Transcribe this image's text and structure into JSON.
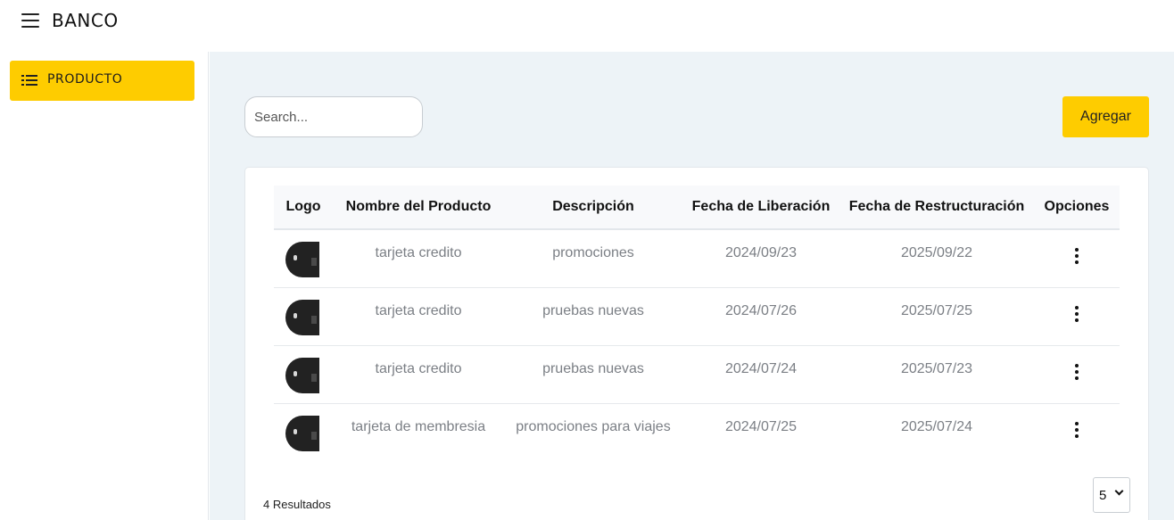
{
  "app": {
    "title": "BANCO"
  },
  "sidebar": {
    "items": [
      {
        "label": "PRODUCTO",
        "icon": "list-icon",
        "active": true
      }
    ]
  },
  "toolbar": {
    "search_placeholder": "Search...",
    "add_label": "Agregar"
  },
  "table": {
    "columns": [
      "Logo",
      "Nombre del Producto",
      "Descripción",
      "Fecha de Liberación",
      "Fecha de Restructuración",
      "Opciones"
    ],
    "rows": [
      {
        "name": "tarjeta credito",
        "description": "promociones",
        "release_date": "2024/09/23",
        "restructure_date": "2025/09/22"
      },
      {
        "name": "tarjeta credito",
        "description": "pruebas nuevas",
        "release_date": "2024/07/26",
        "restructure_date": "2025/07/25"
      },
      {
        "name": "tarjeta credito",
        "description": "pruebas nuevas",
        "release_date": "2024/07/24",
        "restructure_date": "2025/07/23"
      },
      {
        "name": "tarjeta de membresia",
        "description": "promociones para viajes",
        "release_date": "2024/07/25",
        "restructure_date": "2025/07/24"
      }
    ]
  },
  "footer": {
    "results_text": "4 Resultados",
    "page_size": "5"
  },
  "colors": {
    "accent": "#fecc00",
    "main_bg": "#edf3f7",
    "muted_text": "#7b7f85"
  }
}
